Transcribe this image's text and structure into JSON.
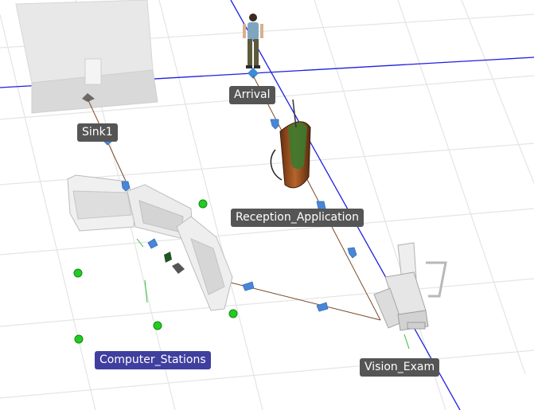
{
  "scene": {
    "nodes": [
      {
        "id": "sink",
        "label": "Sink1",
        "selected": false
      },
      {
        "id": "arrival",
        "label": "Arrival",
        "selected": false
      },
      {
        "id": "reception",
        "label": "Reception_Application",
        "selected": false
      },
      {
        "id": "computer",
        "label": "Computer_Stations",
        "selected": true
      },
      {
        "id": "vision",
        "label": "Vision_Exam",
        "selected": false
      }
    ]
  },
  "colors": {
    "background": "#ffffff",
    "grid": "#e6e6e6",
    "axis": "#1f1fe0",
    "connector": "#7a4a2a",
    "flow_arrow": "#4a86d8",
    "label_bg": "#555555",
    "label_selected_bg": "#3f3f9f",
    "marker": "#22cc22"
  },
  "icons": {
    "flow_direction": "arrow-icon",
    "station_marker": "green-dot-icon",
    "person": "person-figure-icon"
  }
}
